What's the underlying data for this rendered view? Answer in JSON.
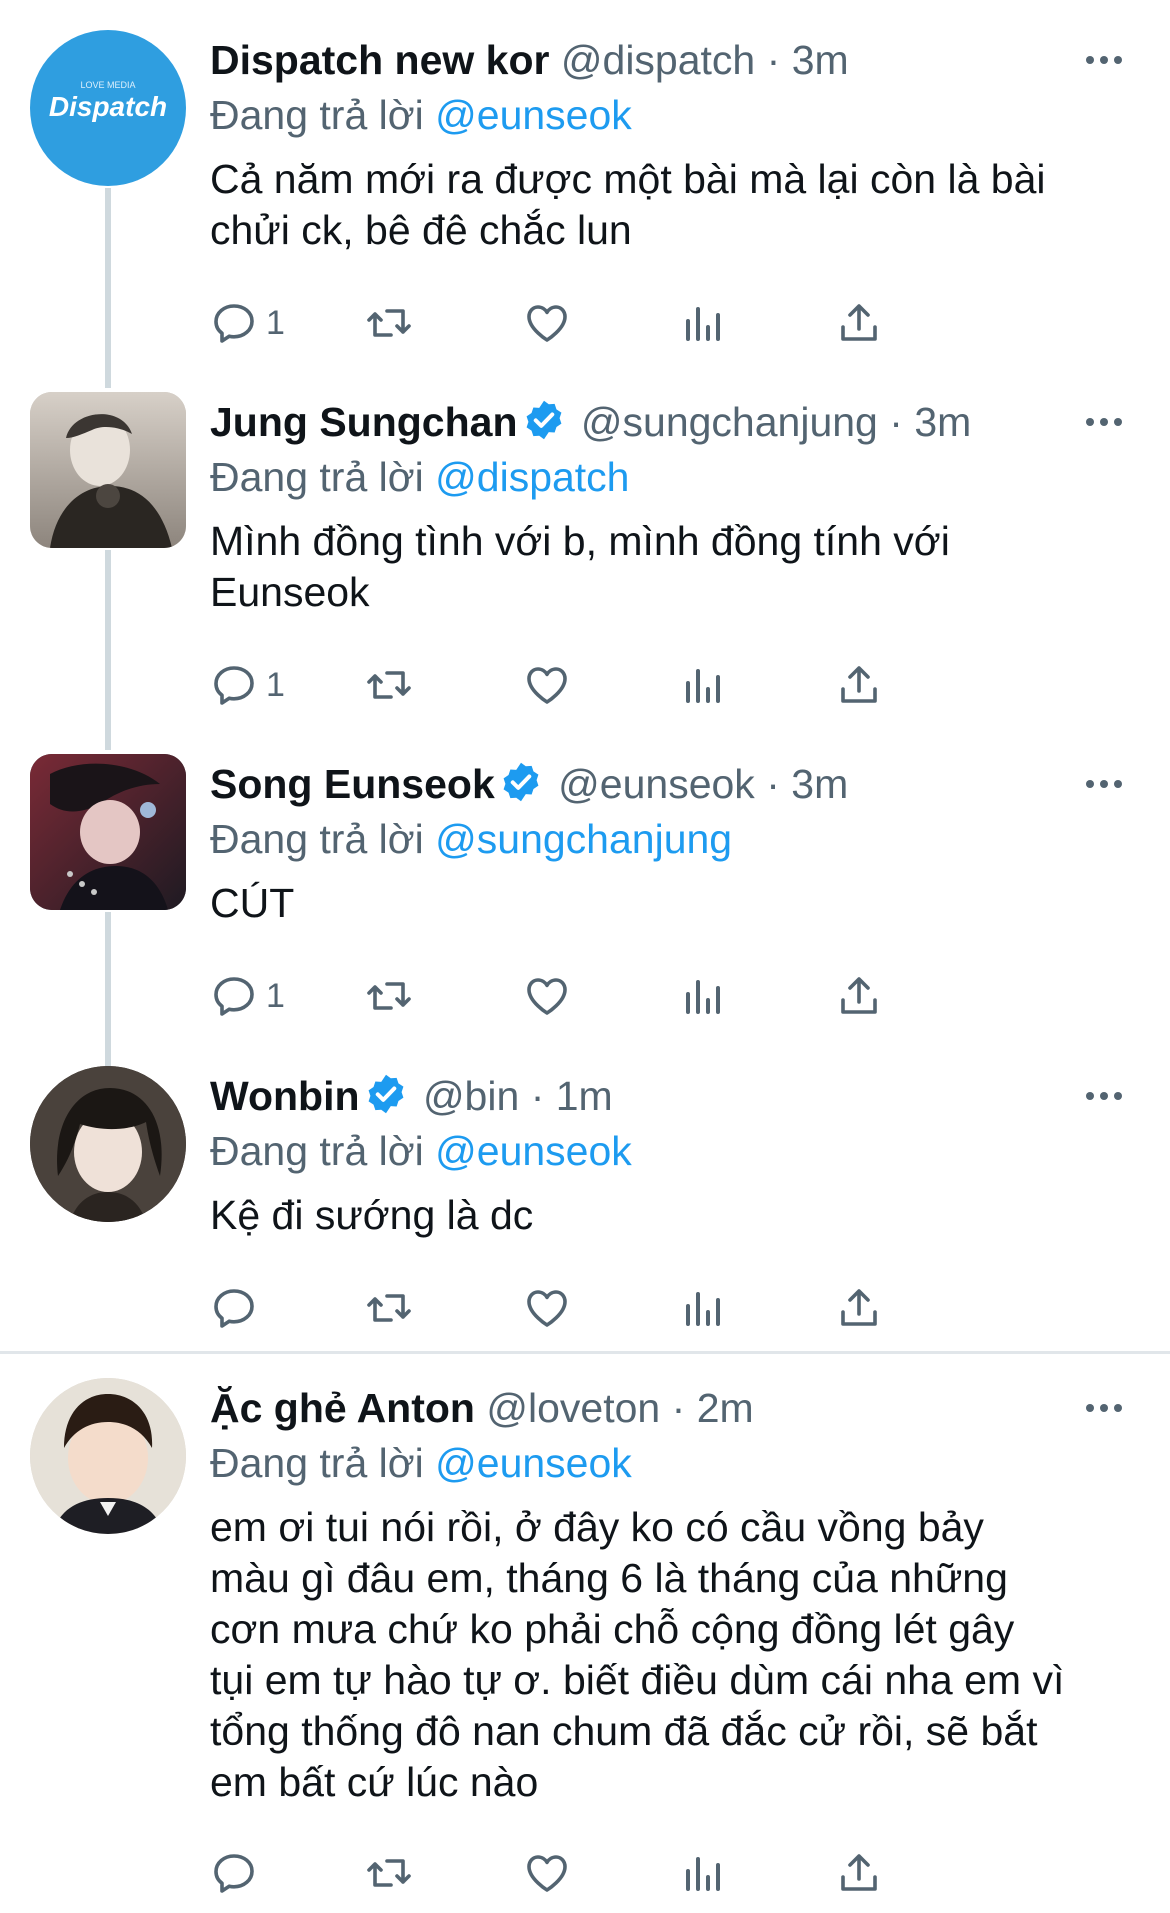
{
  "colors": {
    "link": "#1d9bf0",
    "verified": "#1d9bf0",
    "icon": "#536471",
    "thread_line": "#cfd9de"
  },
  "tweets": [
    {
      "name": "Dispatch new kor",
      "handle": "@dispatch",
      "time": "3m",
      "verified": false,
      "reply_prefix": "Đang trả lời",
      "reply_to": "@eunseok",
      "text": "Cả năm mới ra được một bài mà lại còn là bài\nchửi ck, bê đê chắc lun",
      "reply_count": "1",
      "avatar": {
        "type": "logo",
        "label": "Dispatch"
      }
    },
    {
      "name": "Jung Sungchan",
      "handle": "@sungchanjung",
      "time": "3m",
      "verified": true,
      "reply_prefix": "Đang trả lời",
      "reply_to": "@dispatch",
      "text": "Mình đồng tình với b, mình đồng tính với\nEunseok",
      "reply_count": "1",
      "avatar": {
        "type": "photo"
      }
    },
    {
      "name": "Song Eunseok",
      "handle": "@eunseok",
      "time": "3m",
      "verified": true,
      "reply_prefix": "Đang trả lời",
      "reply_to": "@sungchanjung",
      "text": "CÚT",
      "reply_count": "1",
      "avatar": {
        "type": "photo"
      }
    },
    {
      "name": "Wonbin",
      "handle": "@bin",
      "time": "1m",
      "verified": true,
      "reply_prefix": "Đang trả lời",
      "reply_to": "@eunseok",
      "text": "Kệ đi sướng là dc",
      "reply_count": "",
      "avatar": {
        "type": "photo"
      }
    },
    {
      "name": "Ặc ghẻ Anton",
      "handle": "@loveton",
      "time": "2m",
      "verified": false,
      "reply_prefix": "Đang trả lời",
      "reply_to": "@eunseok",
      "text": "em ơi tui nói rồi, ở đây ko có cầu vồng bảy\nmàu gì đâu em, tháng 6 là tháng của những\ncơn mưa chứ ko phải chỗ cộng đồng lét gây\ntụi em tự hào tự ơ. biết điều dùm cái nha em vì\ntổng thống đô nan chum đã đắc cử rồi, sẽ bắt\nem bất cứ lúc nào",
      "reply_count": "",
      "avatar": {
        "type": "photo"
      }
    }
  ]
}
